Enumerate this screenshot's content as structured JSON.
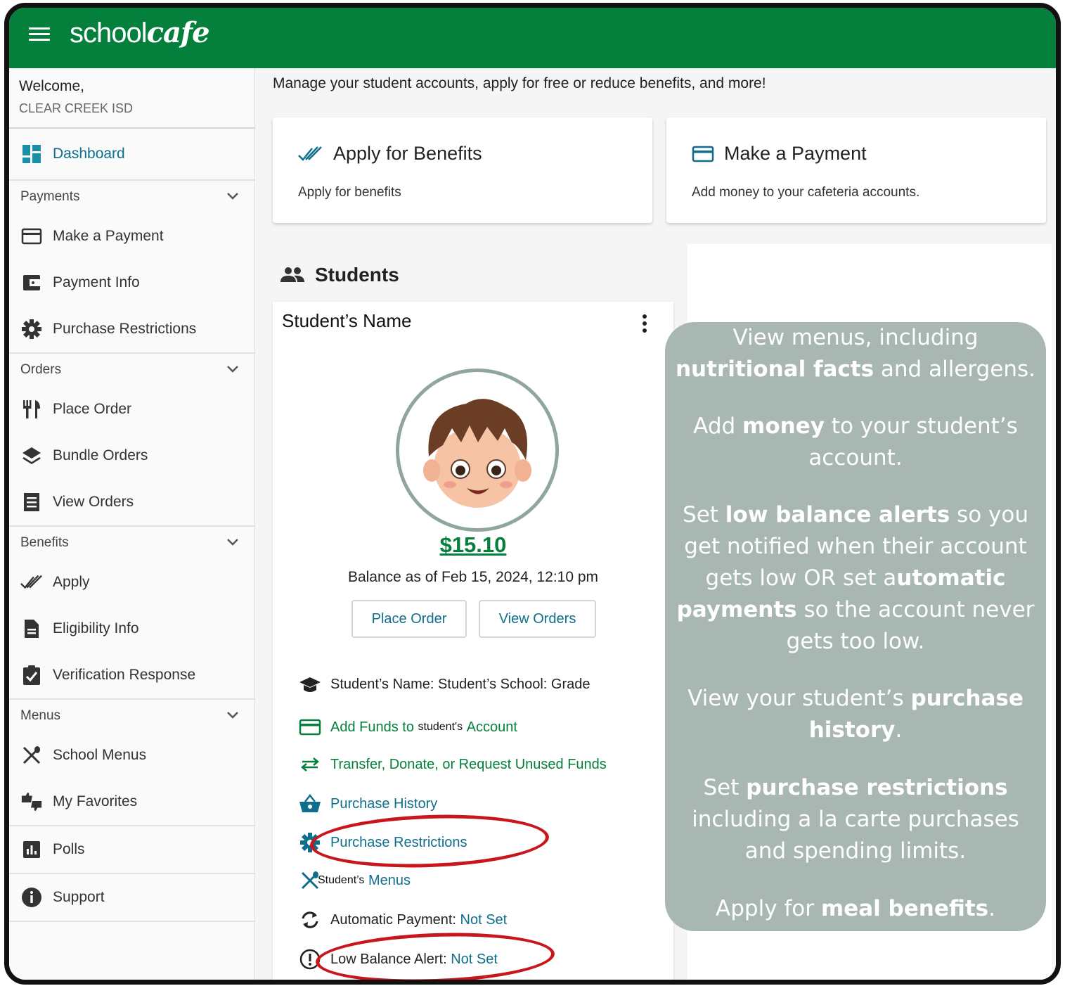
{
  "header": {
    "logo_main": "school",
    "logo_script": "cafe",
    "menu_icon": "hamburger-icon"
  },
  "sidebar": {
    "welcome": "Welcome,",
    "district": "CLEAR CREEK ISD",
    "dashboard": "Dashboard",
    "sections": {
      "payments": "Payments",
      "orders": "Orders",
      "benefits": "Benefits",
      "menus": "Menus"
    },
    "items": {
      "make_payment": "Make a Payment",
      "payment_info": "Payment Info",
      "purchase_restrictions": "Purchase Restrictions",
      "place_order": "Place Order",
      "bundle_orders": "Bundle Orders",
      "view_orders": "View Orders",
      "apply": "Apply",
      "eligibility_info": "Eligibility Info",
      "verification_response": "Verification Response",
      "school_menus": "School Menus",
      "my_favorites": "My Favorites",
      "polls": "Polls",
      "support": "Support"
    }
  },
  "main": {
    "intro": "Manage your student accounts, apply for free or reduce benefits, and more!",
    "cards": {
      "benefits_title": "Apply for Benefits",
      "benefits_sub": "Apply for benefits",
      "payment_title": "Make a Payment",
      "payment_sub": "Add money to your cafeteria accounts."
    },
    "students_heading": "Students",
    "student": {
      "name": "Student’s Name",
      "balance": "$15.10",
      "balance_as_of": "Balance as of Feb 15, 2024, 12:10 pm",
      "place_order_btn": "Place Order",
      "view_orders_btn": "View Orders",
      "school_line": "Student’s Name: Student’s School: Grade",
      "add_funds_a": "Add Funds to",
      "add_funds_b": "student's",
      "add_funds_c": "Account",
      "transfer": "Transfer, Donate, or Request Unused Funds",
      "purchase_history": "Purchase History",
      "purchase_restrictions": "Purchase Restrictions",
      "menus_a": "Student’s",
      "menus_b": "Menus",
      "auto_payment_label": "Automatic Payment:",
      "auto_payment_value": "Not Set",
      "low_balance_label": "Low Balance Alert:",
      "low_balance_value": "Not Set"
    }
  },
  "overlay": {
    "p1_a": "View menus, including ",
    "p1_b": "nutritional facts",
    "p1_c": " and allergens.",
    "p2_a": "Add ",
    "p2_b": "money",
    "p2_c": " to your student’s account.",
    "p3_a": "Set ",
    "p3_b": "low balance alerts",
    "p3_c": " so you get notified when their account gets low OR set a",
    "p3_d": "utomatic payments",
    "p3_e": " so the account never gets too low.",
    "p4_a": "View your student’s ",
    "p4_b": "purchase history",
    "p4_c": ".",
    "p5_a": "Set ",
    "p5_b": "purchase restrictions",
    "p5_c": " including a la carte purchases and spending limits.",
    "p6_a": "Apply for ",
    "p6_b": "meal benefits",
    "p6_c": "."
  },
  "colors": {
    "brand_green": "#047f3c",
    "link_blue": "#0f6e8c",
    "overlay_bg": "#a8b7b1",
    "annotation_red": "#c8161d"
  }
}
